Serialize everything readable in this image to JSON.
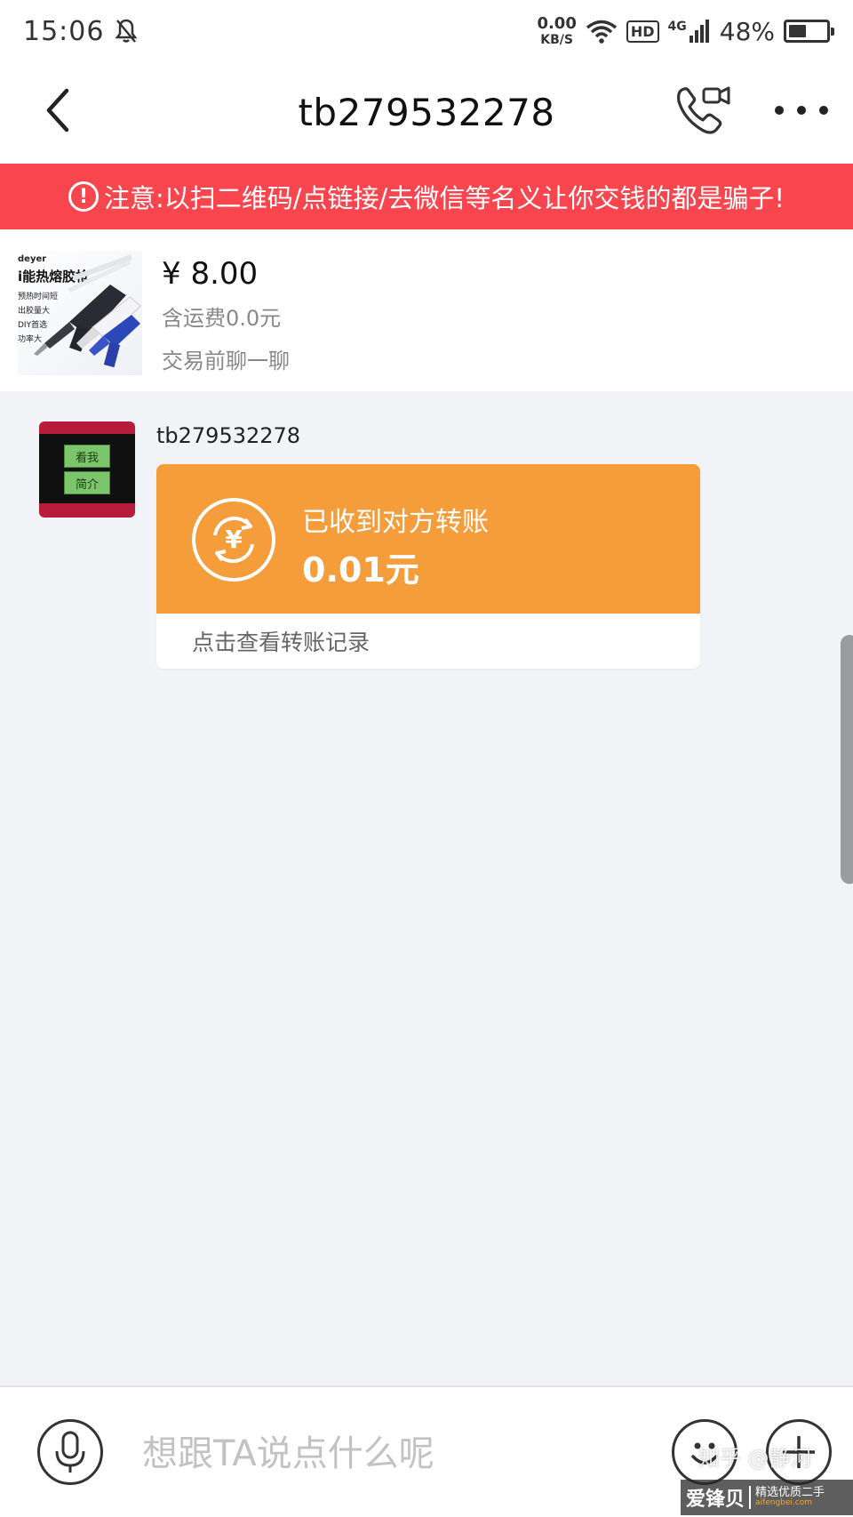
{
  "status_bar": {
    "time": "15:06",
    "net_speed_value": "0.00",
    "net_speed_unit": "KB/S",
    "hd": "HD",
    "signal": "4G",
    "battery_percent": "48%",
    "battery_level": 0.48
  },
  "header": {
    "title": "tb279532278"
  },
  "warning": {
    "icon": "!",
    "text": "注意:以扫二维码/点链接/去微信等名义让你交钱的都是骗子!"
  },
  "product": {
    "thumb_brand": "deyer",
    "thumb_title": "i能热熔胶枪",
    "thumb_features": [
      "预热时间短",
      "出胶量大",
      "DIY首选",
      "功率大"
    ],
    "price": "¥ 8.00",
    "shipping": "含运费0.0元",
    "chat_hint": "交易前聊一聊"
  },
  "chat": {
    "avatar_buttons": [
      "看我",
      "简介"
    ],
    "sender": "tb279532278",
    "transfer": {
      "symbol": "¥",
      "title": "已收到对方转账",
      "amount": "0.01元",
      "footer": "点击查看转账记录"
    }
  },
  "input": {
    "placeholder": "想跟TA说点什么呢"
  },
  "watermark": {
    "zhihu": "知乎 @静河",
    "logo_main": "爱锋贝",
    "logo_sub": "精选优质二手",
    "logo_url": "aifengbei.com"
  },
  "colors": {
    "warning_bg": "#f8454e",
    "transfer_bg": "#f59c3b",
    "page_bg": "#f2f3f7"
  }
}
